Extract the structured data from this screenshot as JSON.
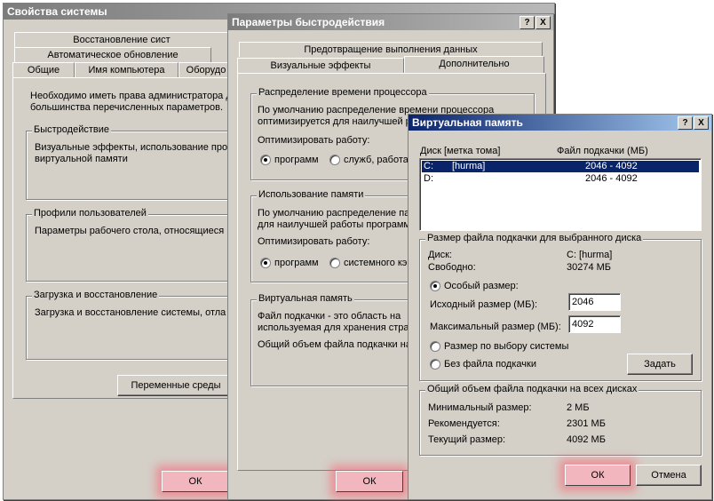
{
  "sys": {
    "title": "Свойства системы",
    "tabs_row1": [
      "Восстановление сист"
    ],
    "tabs_row2": [
      "Автоматическое обновление"
    ],
    "tabs_row3": [
      "Общие",
      "Имя компьютера",
      "Оборудо"
    ],
    "admin_note1": "Необходимо иметь права администратора д",
    "admin_note2": "большинства перечисленных параметров.",
    "perf_title": "Быстродействие",
    "perf_text1": "Визуальные эффекты, использование про",
    "perf_text2": "виртуальной памяти",
    "profiles_title": "Профили пользователей",
    "profiles_text": "Параметры рабочего стола, относящиеся",
    "boot_title": "Загрузка и восстановление",
    "boot_text": "Загрузка и восстановление системы, отла",
    "env_button": "Переменные среды",
    "ok": "ОК"
  },
  "perf": {
    "title": "Параметры быстродействия",
    "help_btn": "?",
    "close_btn": "X",
    "tab_dep": "Предотвращение выполнения данных",
    "tab_visual": "Визуальные эффекты",
    "tab_advanced": "Дополнительно",
    "cpu_title": "Распределение времени процессора",
    "cpu_text1": "По умолчанию распределение времени процессора",
    "cpu_text2": "оптимизируется для наилучшей р",
    "cpu_optimize": "Оптимизировать работу:",
    "cpu_radio1": "программ",
    "cpu_radio2": "служб, работа",
    "mem_title": "Использование памяти",
    "mem_text1": "По умолчанию распределение па",
    "mem_text2": "для наилучшей работы программ",
    "mem_optimize": "Оптимизировать работу:",
    "mem_radio1": "программ",
    "mem_radio2": "системного кэ",
    "vm_title": "Виртуальная память",
    "vm_text1": "Файл подкачки - это область на",
    "vm_text2": "используемая для хранения стра",
    "vm_text3": "Общий объем файла подкачки на",
    "ok": "ОК"
  },
  "vm": {
    "title": "Виртуальная память",
    "help_btn": "?",
    "close_btn": "X",
    "col_disk": "Диск [метка тома]",
    "col_file": "Файл подкачки (МБ)",
    "drives": [
      {
        "drive": "C:",
        "label": "[hurma]",
        "size": "2046 - 4092"
      },
      {
        "drive": "D:",
        "label": "",
        "size": "2046 - 4092"
      }
    ],
    "sel_group": "Размер файла подкачки для выбранного диска",
    "disk_label": "Диск:",
    "disk_value": "C:  [hurma]",
    "free_label": "Свободно:",
    "free_value": "30274 МБ",
    "custom_size": "Особый размер:",
    "initial_label": "Исходный размер (МБ):",
    "initial_value": "2046",
    "max_label": "Максимальный размер (МБ):",
    "max_value": "4092",
    "system_managed": "Размер по выбору системы",
    "no_paging": "Без файла подкачки",
    "set_button": "Задать",
    "total_group": "Общий объем файла подкачки на всех дисках",
    "min_label": "Минимальный размер:",
    "min_value": "2 МБ",
    "rec_label": "Рекомендуется:",
    "rec_value": "2301 МБ",
    "cur_label": "Текущий размер:",
    "cur_value": "4092 МБ",
    "ok": "ОК",
    "cancel": "Отмена"
  }
}
